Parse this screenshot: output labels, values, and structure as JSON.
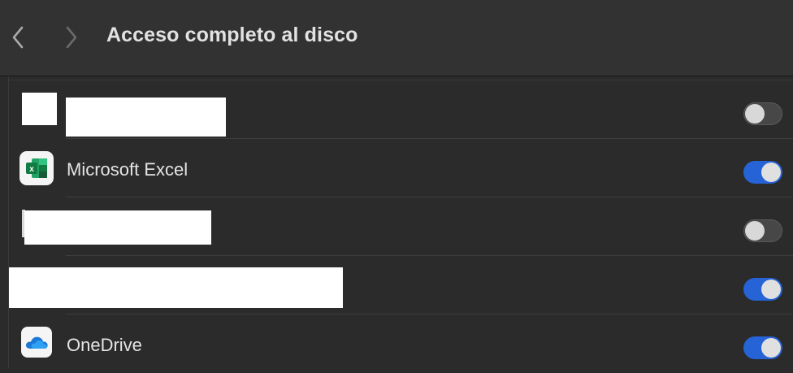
{
  "toolbar": {
    "title": "Acceso completo al disco",
    "back_icon": "chevron-left-icon",
    "forward_icon": "chevron-right-icon"
  },
  "apps": [
    {
      "name": "",
      "redacted": true,
      "enabled": false
    },
    {
      "name": "Microsoft Excel",
      "icon": "microsoft-excel-icon",
      "enabled": true
    },
    {
      "name": "",
      "redacted": true,
      "enabled": false
    },
    {
      "name": "",
      "redacted": true,
      "enabled": true
    },
    {
      "name": "OneDrive",
      "icon": "onedrive-icon",
      "enabled": true
    }
  ],
  "colors": {
    "toggle_on": "#2563d6",
    "toggle_off": "#474747",
    "background": "#2b2b2b"
  }
}
